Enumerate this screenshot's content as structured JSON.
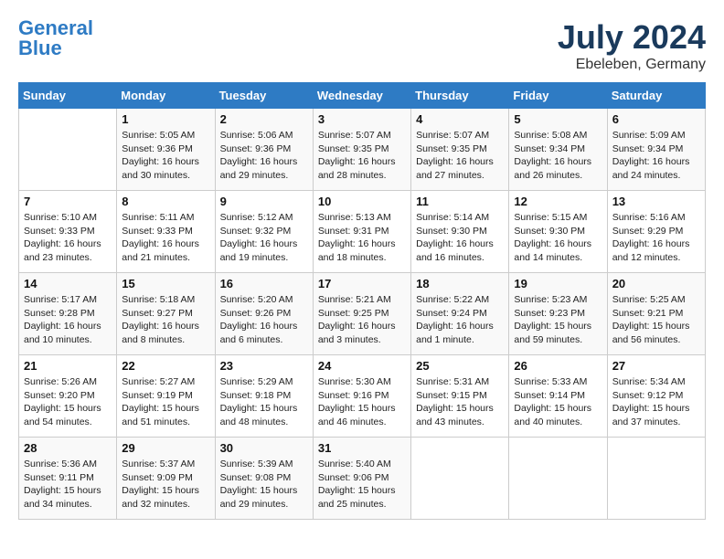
{
  "header": {
    "logo_line1": "General",
    "logo_line2": "Blue",
    "month_year": "July 2024",
    "location": "Ebeleben, Germany"
  },
  "calendar": {
    "days_of_week": [
      "Sunday",
      "Monday",
      "Tuesday",
      "Wednesday",
      "Thursday",
      "Friday",
      "Saturday"
    ],
    "weeks": [
      [
        {
          "day": "",
          "info": ""
        },
        {
          "day": "1",
          "info": "Sunrise: 5:05 AM\nSunset: 9:36 PM\nDaylight: 16 hours\nand 30 minutes."
        },
        {
          "day": "2",
          "info": "Sunrise: 5:06 AM\nSunset: 9:36 PM\nDaylight: 16 hours\nand 29 minutes."
        },
        {
          "day": "3",
          "info": "Sunrise: 5:07 AM\nSunset: 9:35 PM\nDaylight: 16 hours\nand 28 minutes."
        },
        {
          "day": "4",
          "info": "Sunrise: 5:07 AM\nSunset: 9:35 PM\nDaylight: 16 hours\nand 27 minutes."
        },
        {
          "day": "5",
          "info": "Sunrise: 5:08 AM\nSunset: 9:34 PM\nDaylight: 16 hours\nand 26 minutes."
        },
        {
          "day": "6",
          "info": "Sunrise: 5:09 AM\nSunset: 9:34 PM\nDaylight: 16 hours\nand 24 minutes."
        }
      ],
      [
        {
          "day": "7",
          "info": "Sunrise: 5:10 AM\nSunset: 9:33 PM\nDaylight: 16 hours\nand 23 minutes."
        },
        {
          "day": "8",
          "info": "Sunrise: 5:11 AM\nSunset: 9:33 PM\nDaylight: 16 hours\nand 21 minutes."
        },
        {
          "day": "9",
          "info": "Sunrise: 5:12 AM\nSunset: 9:32 PM\nDaylight: 16 hours\nand 19 minutes."
        },
        {
          "day": "10",
          "info": "Sunrise: 5:13 AM\nSunset: 9:31 PM\nDaylight: 16 hours\nand 18 minutes."
        },
        {
          "day": "11",
          "info": "Sunrise: 5:14 AM\nSunset: 9:30 PM\nDaylight: 16 hours\nand 16 minutes."
        },
        {
          "day": "12",
          "info": "Sunrise: 5:15 AM\nSunset: 9:30 PM\nDaylight: 16 hours\nand 14 minutes."
        },
        {
          "day": "13",
          "info": "Sunrise: 5:16 AM\nSunset: 9:29 PM\nDaylight: 16 hours\nand 12 minutes."
        }
      ],
      [
        {
          "day": "14",
          "info": "Sunrise: 5:17 AM\nSunset: 9:28 PM\nDaylight: 16 hours\nand 10 minutes."
        },
        {
          "day": "15",
          "info": "Sunrise: 5:18 AM\nSunset: 9:27 PM\nDaylight: 16 hours\nand 8 minutes."
        },
        {
          "day": "16",
          "info": "Sunrise: 5:20 AM\nSunset: 9:26 PM\nDaylight: 16 hours\nand 6 minutes."
        },
        {
          "day": "17",
          "info": "Sunrise: 5:21 AM\nSunset: 9:25 PM\nDaylight: 16 hours\nand 3 minutes."
        },
        {
          "day": "18",
          "info": "Sunrise: 5:22 AM\nSunset: 9:24 PM\nDaylight: 16 hours\nand 1 minute."
        },
        {
          "day": "19",
          "info": "Sunrise: 5:23 AM\nSunset: 9:23 PM\nDaylight: 15 hours\nand 59 minutes."
        },
        {
          "day": "20",
          "info": "Sunrise: 5:25 AM\nSunset: 9:21 PM\nDaylight: 15 hours\nand 56 minutes."
        }
      ],
      [
        {
          "day": "21",
          "info": "Sunrise: 5:26 AM\nSunset: 9:20 PM\nDaylight: 15 hours\nand 54 minutes."
        },
        {
          "day": "22",
          "info": "Sunrise: 5:27 AM\nSunset: 9:19 PM\nDaylight: 15 hours\nand 51 minutes."
        },
        {
          "day": "23",
          "info": "Sunrise: 5:29 AM\nSunset: 9:18 PM\nDaylight: 15 hours\nand 48 minutes."
        },
        {
          "day": "24",
          "info": "Sunrise: 5:30 AM\nSunset: 9:16 PM\nDaylight: 15 hours\nand 46 minutes."
        },
        {
          "day": "25",
          "info": "Sunrise: 5:31 AM\nSunset: 9:15 PM\nDaylight: 15 hours\nand 43 minutes."
        },
        {
          "day": "26",
          "info": "Sunrise: 5:33 AM\nSunset: 9:14 PM\nDaylight: 15 hours\nand 40 minutes."
        },
        {
          "day": "27",
          "info": "Sunrise: 5:34 AM\nSunset: 9:12 PM\nDaylight: 15 hours\nand 37 minutes."
        }
      ],
      [
        {
          "day": "28",
          "info": "Sunrise: 5:36 AM\nSunset: 9:11 PM\nDaylight: 15 hours\nand 34 minutes."
        },
        {
          "day": "29",
          "info": "Sunrise: 5:37 AM\nSunset: 9:09 PM\nDaylight: 15 hours\nand 32 minutes."
        },
        {
          "day": "30",
          "info": "Sunrise: 5:39 AM\nSunset: 9:08 PM\nDaylight: 15 hours\nand 29 minutes."
        },
        {
          "day": "31",
          "info": "Sunrise: 5:40 AM\nSunset: 9:06 PM\nDaylight: 15 hours\nand 25 minutes."
        },
        {
          "day": "",
          "info": ""
        },
        {
          "day": "",
          "info": ""
        },
        {
          "day": "",
          "info": ""
        }
      ]
    ]
  }
}
